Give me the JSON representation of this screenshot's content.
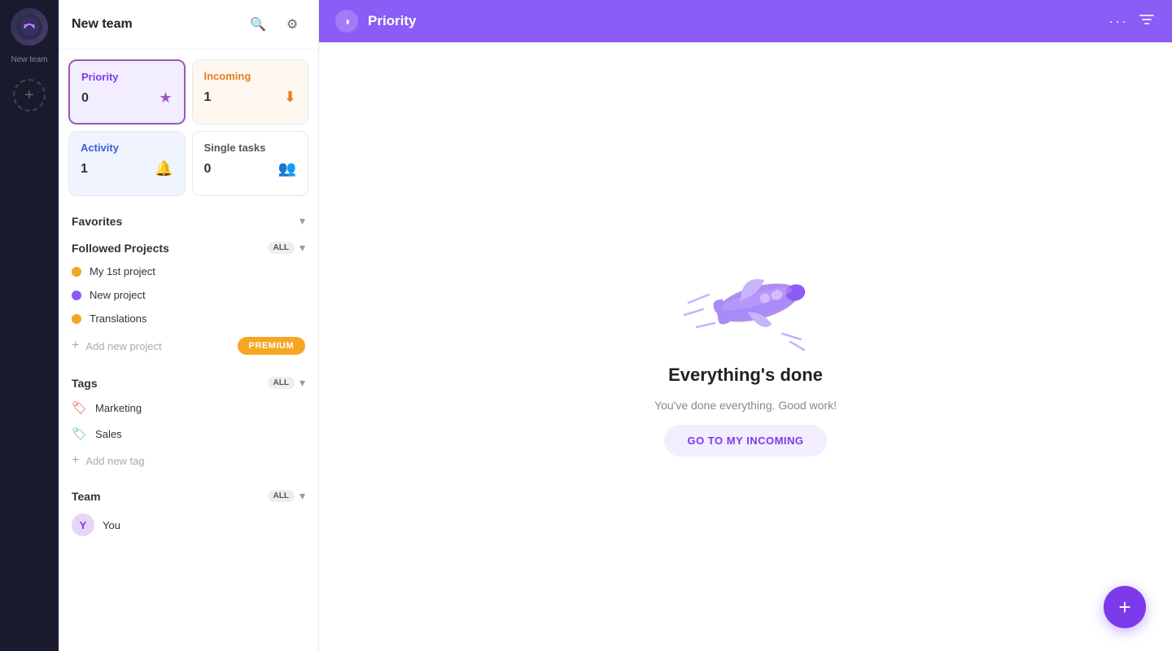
{
  "iconRail": {
    "teamName": "New team",
    "addLabel": "+"
  },
  "sidebar": {
    "title": "New team",
    "searchLabel": "Search",
    "settingsLabel": "Settings",
    "quickCards": [
      {
        "id": "priority",
        "label": "Priority",
        "count": "0",
        "iconType": "star",
        "type": "priority"
      },
      {
        "id": "incoming",
        "label": "Incoming",
        "count": "1",
        "iconType": "inbox",
        "type": "incoming"
      },
      {
        "id": "activity",
        "label": "Activity",
        "count": "1",
        "iconType": "bell",
        "type": "activity"
      },
      {
        "id": "single-tasks",
        "label": "Single tasks",
        "count": "0",
        "iconType": "people",
        "type": "single-tasks"
      }
    ],
    "favorites": {
      "label": "Favorites",
      "chevron": "▾"
    },
    "followedProjects": {
      "label": "Followed Projects",
      "badge": "ALL",
      "chevron": "▾",
      "items": [
        {
          "name": "My 1st project",
          "color": "#f5a623"
        },
        {
          "name": "New project",
          "color": "#8b5cf6"
        },
        {
          "name": "Translations",
          "color": "#f5a623"
        }
      ],
      "addLabel": "Add new project",
      "premiumLabel": "PREMIUM"
    },
    "tags": {
      "label": "Tags",
      "badge": "ALL",
      "chevron": "▾",
      "items": [
        {
          "name": "Marketing",
          "color": "#e53e3e"
        },
        {
          "name": "Sales",
          "color": "#38b2ac"
        }
      ],
      "addLabel": "Add new tag"
    },
    "team": {
      "label": "Team",
      "badge": "ALL",
      "chevron": "▾",
      "members": [
        {
          "name": "You",
          "initials": "Y",
          "bg": "#e8d5f5",
          "color": "#7c3aed"
        }
      ]
    }
  },
  "topbar": {
    "title": "Priority",
    "dotsLabel": "···",
    "sortIconLabel": "sort"
  },
  "main": {
    "illustrationAlt": "airplane illustration",
    "heading": "Everything's done",
    "subheading": "You've done everything. Good work!",
    "ctaLabel": "GO TO MY INCOMING"
  },
  "fab": {
    "label": "+"
  }
}
